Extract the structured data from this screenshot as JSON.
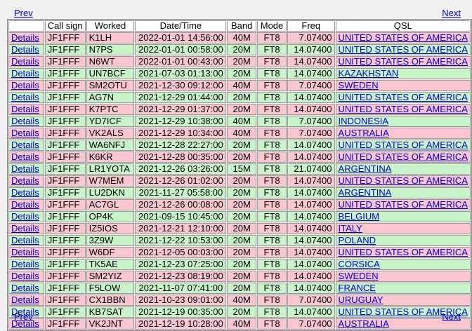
{
  "nav": {
    "prev": "Prev",
    "next": "Next"
  },
  "columns": [
    "",
    "Call sign",
    "Worked",
    "Date/Time",
    "Band",
    "Mode",
    "Freq",
    "QSL"
  ],
  "details_label": "Details",
  "row_colors": {
    "pink": "#fbc6cf",
    "green": "#c9f4c9"
  },
  "rows": [
    {
      "tone": "pink",
      "call": "JF1FFF",
      "worked": "K1LH",
      "datetime": "2022-01-01 14:56:00",
      "band": "40M",
      "mode": "FT8",
      "freq": "7.07400",
      "qsl": "UNITED STATES OF AMERICA"
    },
    {
      "tone": "green",
      "call": "JF1FFF",
      "worked": "N7PS",
      "datetime": "2022-01-01 00:58:00",
      "band": "20M",
      "mode": "FT8",
      "freq": "14.07400",
      "qsl": "UNITED STATES OF AMERICA"
    },
    {
      "tone": "pink",
      "call": "JF1FFF",
      "worked": "N6WT",
      "datetime": "2022-01-01 00:43:00",
      "band": "20M",
      "mode": "FT8",
      "freq": "14.07400",
      "qsl": "UNITED STATES OF AMERICA"
    },
    {
      "tone": "green",
      "call": "JF1FFF",
      "worked": "UN7BCF",
      "datetime": "2021-07-03 01:13:00",
      "band": "20M",
      "mode": "FT8",
      "freq": "14.07400",
      "qsl": "KAZAKHSTAN"
    },
    {
      "tone": "pink",
      "call": "JF1FFF",
      "worked": "SM2OTU",
      "datetime": "2021-12-30 09:12:00",
      "band": "40M",
      "mode": "FT8",
      "freq": "7.07400",
      "qsl": "SWEDEN"
    },
    {
      "tone": "green",
      "call": "JF1FFF",
      "worked": "AG7N",
      "datetime": "2021-12-29 01:44:00",
      "band": "20M",
      "mode": "FT8",
      "freq": "14.07400",
      "qsl": "UNITED STATES OF AMERICA"
    },
    {
      "tone": "pink",
      "call": "JF1FFF",
      "worked": "K7PTC",
      "datetime": "2021-12-29 01:37:00",
      "band": "20M",
      "mode": "FT8",
      "freq": "14.07400",
      "qsl": "UNITED STATES OF AMERICA"
    },
    {
      "tone": "green",
      "call": "JF1FFF",
      "worked": "YD7ICF",
      "datetime": "2021-12-29 10:38:00",
      "band": "40M",
      "mode": "FT8",
      "freq": "7.07400",
      "qsl": "INDONESIA"
    },
    {
      "tone": "pink",
      "call": "JF1FFF",
      "worked": "VK2ALS",
      "datetime": "2021-12-29 10:34:00",
      "band": "40M",
      "mode": "FT8",
      "freq": "7.07400",
      "qsl": "AUSTRALIA"
    },
    {
      "tone": "green",
      "call": "JF1FFF",
      "worked": "WA6NFJ",
      "datetime": "2021-12-28 22:27:00",
      "band": "20M",
      "mode": "FT8",
      "freq": "14.07400",
      "qsl": "UNITED STATES OF AMERICA"
    },
    {
      "tone": "pink",
      "call": "JF1FFF",
      "worked": "K6KR",
      "datetime": "2021-12-28 00:35:00",
      "band": "20M",
      "mode": "FT8",
      "freq": "14.07400",
      "qsl": "UNITED STATES OF AMERICA"
    },
    {
      "tone": "green",
      "call": "JF1FFF",
      "worked": "LR1YOTA",
      "datetime": "2021-12-26 03:26:00",
      "band": "15M",
      "mode": "FT8",
      "freq": "21.07400",
      "qsl": "ARGENTINA"
    },
    {
      "tone": "pink",
      "call": "JF1FFF",
      "worked": "W7MEM",
      "datetime": "2021-12-26 01:02:00",
      "band": "20M",
      "mode": "FT8",
      "freq": "14.07400",
      "qsl": "UNITED STATES OF AMERICA"
    },
    {
      "tone": "green",
      "call": "JF1FFF",
      "worked": "LU2DKN",
      "datetime": "2021-11-27 05:58:00",
      "band": "20M",
      "mode": "FT8",
      "freq": "14.07400",
      "qsl": "ARGENTINA"
    },
    {
      "tone": "pink",
      "call": "JF1FFF",
      "worked": "AC7GL",
      "datetime": "2021-12-26 00:08:00",
      "band": "20M",
      "mode": "FT8",
      "freq": "14.07400",
      "qsl": "UNITED STATES OF AMERICA"
    },
    {
      "tone": "green",
      "call": "JF1FFF",
      "worked": "OP4K",
      "datetime": "2021-09-15 10:45:00",
      "band": "20M",
      "mode": "FT8",
      "freq": "14.07400",
      "qsl": "BELGIUM"
    },
    {
      "tone": "pink",
      "call": "JF1FFF",
      "worked": "IZ5IOS",
      "datetime": "2021-12-21 12:10:00",
      "band": "20M",
      "mode": "FT8",
      "freq": "14.07400",
      "qsl": "ITALY"
    },
    {
      "tone": "green",
      "call": "JF1FFF",
      "worked": "3Z9W",
      "datetime": "2021-12-22 10:53:00",
      "band": "20M",
      "mode": "FT8",
      "freq": "14.07400",
      "qsl": "POLAND"
    },
    {
      "tone": "pink",
      "call": "JF1FFF",
      "worked": "W6DF",
      "datetime": "2021-12-05 00:03:00",
      "band": "20M",
      "mode": "FT8",
      "freq": "14.07400",
      "qsl": "UNITED STATES OF AMERICA"
    },
    {
      "tone": "green",
      "call": "JF1FFF",
      "worked": "TK5AE",
      "datetime": "2021-12-23 07:25:00",
      "band": "20M",
      "mode": "FT8",
      "freq": "14.07400",
      "qsl": "CORSICA"
    },
    {
      "tone": "pink",
      "call": "JF1FFF",
      "worked": "SM2YIZ",
      "datetime": "2021-12-23 08:19:00",
      "band": "20M",
      "mode": "FT8",
      "freq": "14.07400",
      "qsl": "SWEDEN"
    },
    {
      "tone": "green",
      "call": "JF1FFF",
      "worked": "F5LOW",
      "datetime": "2021-11-07 07:41:00",
      "band": "20M",
      "mode": "FT8",
      "freq": "14.07400",
      "qsl": "FRANCE"
    },
    {
      "tone": "pink",
      "call": "JF1FFF",
      "worked": "CX1BBN",
      "datetime": "2021-10-23 09:01:00",
      "band": "40M",
      "mode": "FT8",
      "freq": "7.07400",
      "qsl": "URUGUAY"
    },
    {
      "tone": "green",
      "call": "JF1FFF",
      "worked": "KB7SAT",
      "datetime": "2021-12-19 00:35:00",
      "band": "20M",
      "mode": "FT8",
      "freq": "14.07400",
      "qsl": "UNITED STATES OF AMERICA"
    },
    {
      "tone": "pink",
      "call": "JF1FFF",
      "worked": "VK2JNT",
      "datetime": "2021-12-19 10:28:00",
      "band": "40M",
      "mode": "FT8",
      "freq": "7.07400",
      "qsl": "AUSTRALIA"
    }
  ]
}
